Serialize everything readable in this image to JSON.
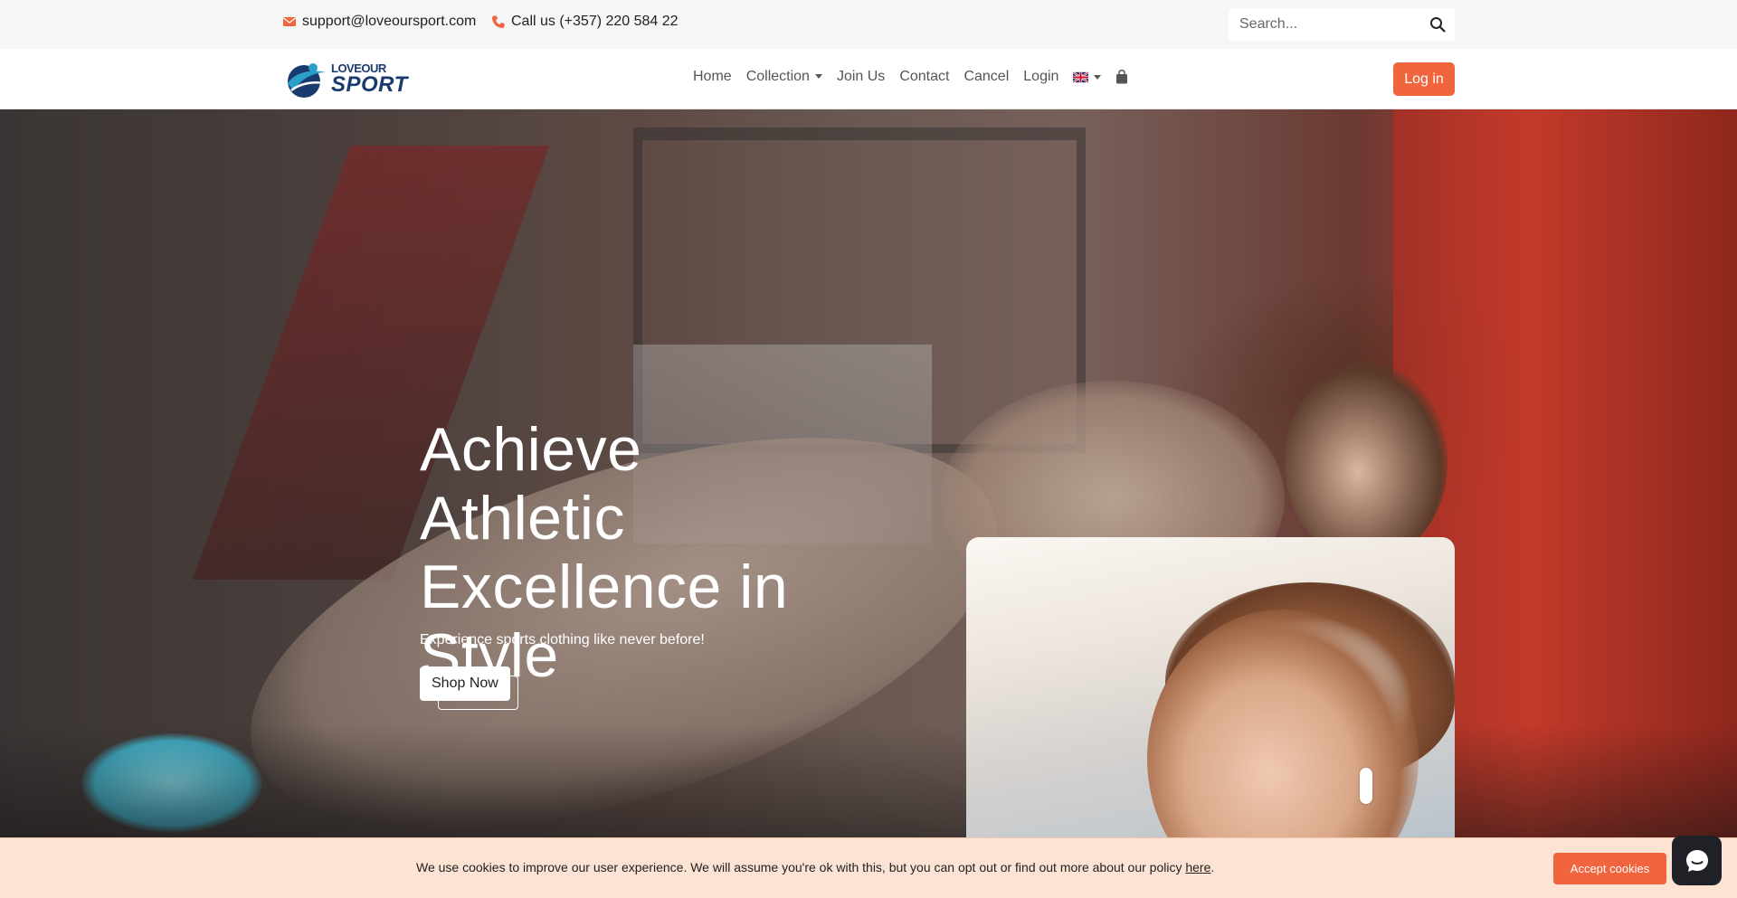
{
  "topbar": {
    "email": "support@loveoursport.com",
    "phone": "Call us (+357) 220 584 22",
    "search_placeholder": "Search...",
    "icons": {
      "email": "envelope-icon",
      "phone": "phone-icon",
      "search": "search-icon"
    }
  },
  "brand": {
    "logo_line1": "LOVEOUR",
    "logo_line2": "SPORT",
    "color_primary": "#1a3b6e",
    "color_accent": "#2a9fc9"
  },
  "nav": {
    "items": [
      {
        "label": "Home"
      },
      {
        "label": "Collection"
      },
      {
        "label": "Join Us"
      },
      {
        "label": "Contact"
      },
      {
        "label": "Cancel"
      },
      {
        "label": "Login"
      }
    ],
    "language_icon": "uk-flag-icon",
    "cart_icon": "shopping-bag-icon",
    "login_button": "Log in",
    "accent_color": "#f0643e"
  },
  "hero": {
    "title": "Achieve Athletic Excellence in Style",
    "subtitle": "Experience sports clothing like never before!",
    "cta": "Shop Now"
  },
  "cookie": {
    "text": "We use cookies to improve our user experience. We will assume you're ok with this, but you can opt out or find out more about our policy ",
    "link": "here",
    "after": ".",
    "accept": "Accept cookies"
  },
  "chat": {
    "icon": "chat-bubble-icon"
  }
}
